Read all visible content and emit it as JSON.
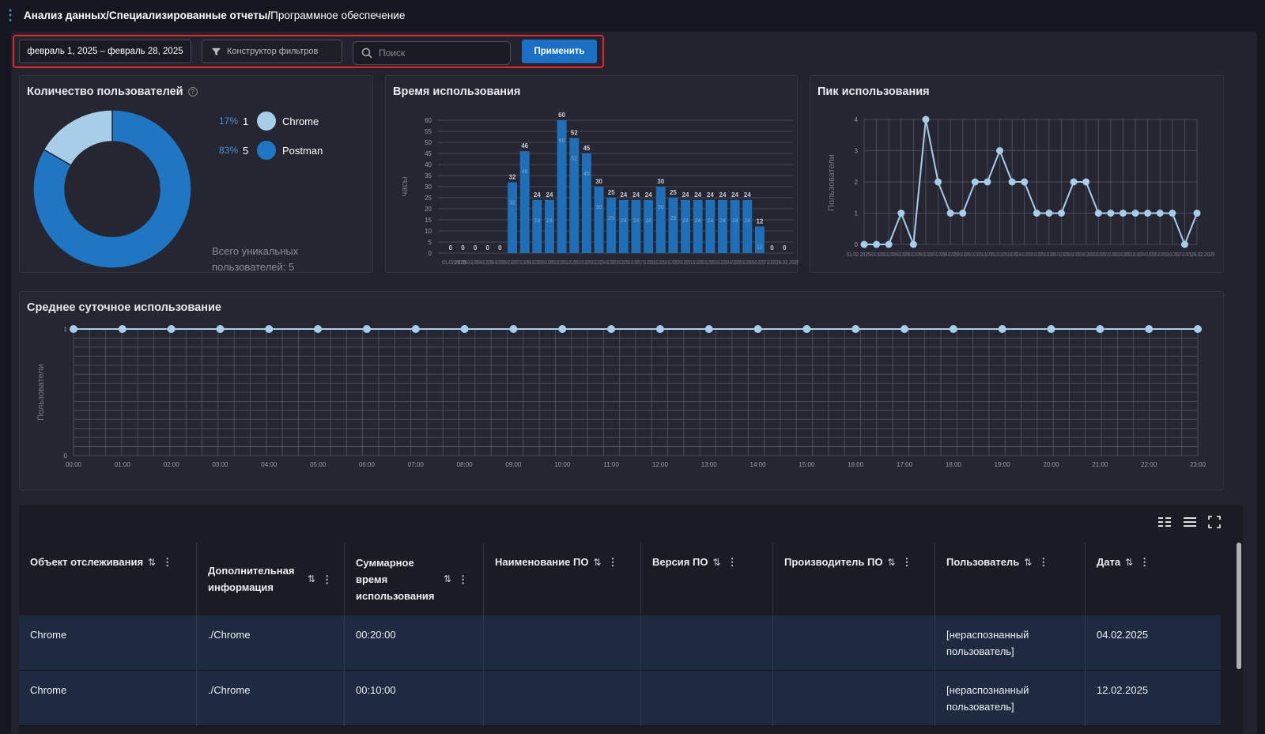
{
  "breadcrumb": {
    "path_bold": "Анализ данных/Специализированные отчеты/",
    "current": "Программное обеспечение"
  },
  "filters": {
    "date_range": "февраль 1, 2025 – февраль 28, 2025",
    "filter_builder_label": "Конструктор фильтров",
    "search_placeholder": "Поиск",
    "apply_label": "Применить"
  },
  "users_panel": {
    "title": "Количество пользователей",
    "legend": [
      {
        "pct": "17%",
        "count": "1",
        "label": "Chrome",
        "color": "#a8cde8"
      },
      {
        "pct": "83%",
        "count": "5",
        "label": "Postman",
        "color": "#1f77c4"
      }
    ],
    "total_label": "Всего уникальных пользователей: 5"
  },
  "usage_time_panel": {
    "title": "Время использования"
  },
  "peak_panel": {
    "title": "Пик использования"
  },
  "daily_panel": {
    "title": "Среднее суточное использование"
  },
  "chart_data": [
    {
      "type": "pie",
      "title": "Количество пользователей",
      "labels": [
        "Chrome",
        "Postman"
      ],
      "values": [
        1,
        5
      ],
      "percents": [
        17,
        83
      ],
      "colors": [
        "#a8cde8",
        "#1f77c4"
      ]
    },
    {
      "type": "bar",
      "title": "Время использования",
      "ylabel": "часы",
      "ylim": [
        0,
        60
      ],
      "yticks": [
        0,
        5,
        10,
        15,
        20,
        25,
        30,
        35,
        40,
        45,
        50,
        55,
        60
      ],
      "x_first": "01.02.2025",
      "x_last": "28.02.2025",
      "values": [
        0,
        0,
        0,
        0,
        0,
        32,
        46,
        24,
        24,
        60,
        52,
        45,
        30,
        25,
        24,
        24,
        24,
        30,
        25,
        24,
        24,
        24,
        24,
        24,
        24,
        12,
        0,
        0
      ],
      "color": "#1f6fb8"
    },
    {
      "type": "line",
      "title": "Пик использования",
      "ylabel": "Пользователи",
      "ylim": [
        0,
        4
      ],
      "yticks": [
        0,
        1,
        2,
        3,
        4
      ],
      "x_first": "01.02.2025",
      "x_last": "28.02.2025",
      "values": [
        0,
        0,
        0,
        1,
        0,
        4,
        2,
        1,
        1,
        2,
        2,
        3,
        2,
        2,
        1,
        1,
        1,
        2,
        2,
        1,
        1,
        1,
        1,
        1,
        1,
        1,
        0,
        1
      ],
      "color": "#a8cde8"
    },
    {
      "type": "line",
      "title": "Среднее суточное использование",
      "ylabel": "Пользователи",
      "ylim": [
        0,
        1
      ],
      "yticks": [
        0,
        1
      ],
      "categories": [
        "00:00",
        "01:00",
        "02:00",
        "03:00",
        "04:00",
        "05:00",
        "06:00",
        "07:00",
        "08:00",
        "09:00",
        "10:00",
        "11:00",
        "12:00",
        "13:00",
        "14:00",
        "15:00",
        "16:00",
        "17:00",
        "18:00",
        "19:00",
        "20:00",
        "21:00",
        "22:00",
        "23:00"
      ],
      "values": [
        1,
        1,
        1,
        1,
        1,
        1,
        1,
        1,
        1,
        1,
        1,
        1,
        1,
        1,
        1,
        1,
        1,
        1,
        1,
        1,
        1,
        1,
        1,
        1
      ],
      "color": "#a8cde8"
    }
  ],
  "table": {
    "columns": [
      {
        "label": "Объект отслеживания"
      },
      {
        "label": "Дополнительная информация"
      },
      {
        "label": "Суммарное время использования"
      },
      {
        "label": "Наименование ПО"
      },
      {
        "label": "Версия ПО"
      },
      {
        "label": "Производитель ПО"
      },
      {
        "label": "Пользователь"
      },
      {
        "label": "Дата"
      }
    ],
    "sort_icon": "⇅",
    "rows": [
      {
        "c0": "Chrome",
        "c1": "./Chrome",
        "c2": "00:20:00",
        "c3": "",
        "c4": "",
        "c5": "",
        "c6": "[нераспознанный пользователь]",
        "c7": "04.02.2025"
      },
      {
        "c0": "Chrome",
        "c1": "./Chrome",
        "c2": "00:10:00",
        "c3": "",
        "c4": "",
        "c5": "",
        "c6": "[нераспознанный пользователь]",
        "c7": "12.02.2025"
      }
    ]
  }
}
